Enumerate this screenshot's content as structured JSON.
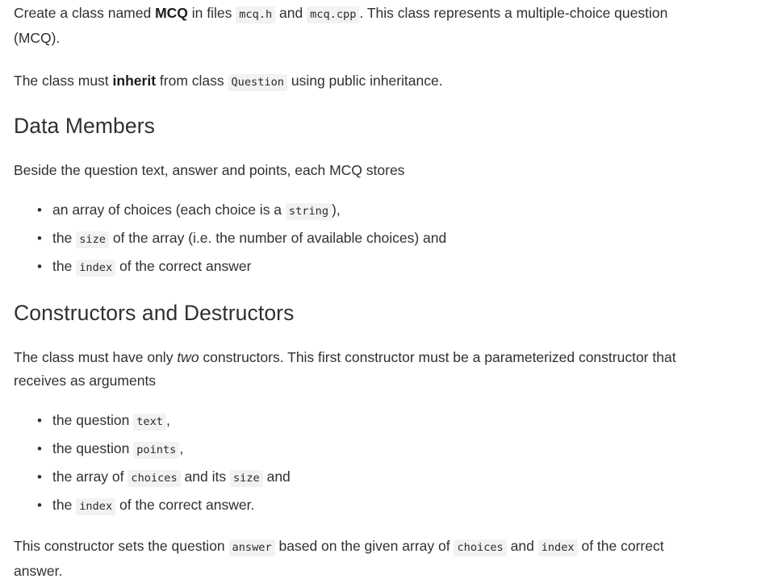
{
  "document": {
    "blocks": [
      {
        "id": "intro-paragraph",
        "type": "paragraph",
        "runs": [
          {
            "t": "text",
            "v": "Create a class named "
          },
          {
            "t": "bold",
            "v": "MCQ"
          },
          {
            "t": "text",
            "v": " in files "
          },
          {
            "t": "code",
            "v": "mcq.h"
          },
          {
            "t": "text",
            "v": " and "
          },
          {
            "t": "code",
            "v": "mcq.cpp"
          },
          {
            "t": "text",
            "v": ". This class represents a multiple-choice question (MCQ)."
          }
        ]
      },
      {
        "id": "inheritance-paragraph",
        "type": "paragraph",
        "runs": [
          {
            "t": "text",
            "v": "The class must "
          },
          {
            "t": "bold",
            "v": "inherit"
          },
          {
            "t": "text",
            "v": " from class "
          },
          {
            "t": "code",
            "v": "Question"
          },
          {
            "t": "text",
            "v": " using public inheritance."
          }
        ]
      },
      {
        "id": "data-members-heading",
        "type": "heading",
        "text": "Data Members"
      },
      {
        "id": "data-members-intro",
        "type": "paragraph",
        "runs": [
          {
            "t": "text",
            "v": "Beside the question text, answer and points, each MCQ stores"
          }
        ]
      },
      {
        "id": "data-members-list",
        "type": "list",
        "items": [
          [
            {
              "t": "text",
              "v": "an array of choices (each choice is a "
            },
            {
              "t": "code",
              "v": "string"
            },
            {
              "t": "text",
              "v": "),"
            }
          ],
          [
            {
              "t": "text",
              "v": "the "
            },
            {
              "t": "code",
              "v": "size"
            },
            {
              "t": "text",
              "v": " of the array (i.e. the number of available choices) and"
            }
          ],
          [
            {
              "t": "text",
              "v": "the "
            },
            {
              "t": "code",
              "v": "index"
            },
            {
              "t": "text",
              "v": " of the correct answer"
            }
          ]
        ]
      },
      {
        "id": "constructors-heading",
        "type": "heading",
        "text": "Constructors and Destructors"
      },
      {
        "id": "constructors-intro",
        "type": "paragraph",
        "runs": [
          {
            "t": "text",
            "v": "The class must have only "
          },
          {
            "t": "italic",
            "v": "two"
          },
          {
            "t": "text",
            "v": " constructors. This first constructor must be a parameterized constructor that receives as arguments"
          }
        ]
      },
      {
        "id": "constructor-args-list",
        "type": "list",
        "items": [
          [
            {
              "t": "text",
              "v": "the question "
            },
            {
              "t": "code",
              "v": "text"
            },
            {
              "t": "text",
              "v": ","
            }
          ],
          [
            {
              "t": "text",
              "v": "the question "
            },
            {
              "t": "code",
              "v": "points"
            },
            {
              "t": "text",
              "v": ","
            }
          ],
          [
            {
              "t": "text",
              "v": "the array of "
            },
            {
              "t": "code",
              "v": "choices"
            },
            {
              "t": "text",
              "v": " and its "
            },
            {
              "t": "code",
              "v": "size"
            },
            {
              "t": "text",
              "v": " and"
            }
          ],
          [
            {
              "t": "text",
              "v": "the "
            },
            {
              "t": "code",
              "v": "index"
            },
            {
              "t": "text",
              "v": " of the correct answer."
            }
          ]
        ]
      },
      {
        "id": "constructor-answer-paragraph",
        "type": "paragraph",
        "runs": [
          {
            "t": "text",
            "v": "This constructor sets the question "
          },
          {
            "t": "code",
            "v": "answer"
          },
          {
            "t": "text",
            "v": " based on the given array of "
          },
          {
            "t": "code",
            "v": "choices"
          },
          {
            "t": "text",
            "v": " and "
          },
          {
            "t": "code",
            "v": "index"
          },
          {
            "t": "text",
            "v": " of the correct answer."
          }
        ]
      }
    ]
  },
  "style": {
    "page_background": "#ffffff",
    "text_color": "#2f3033",
    "heading_color": "#2f3033",
    "code_background": "#f2f2f2",
    "code_text_color": "#2b2b2b",
    "bold_color": "#1b1c1e"
  }
}
